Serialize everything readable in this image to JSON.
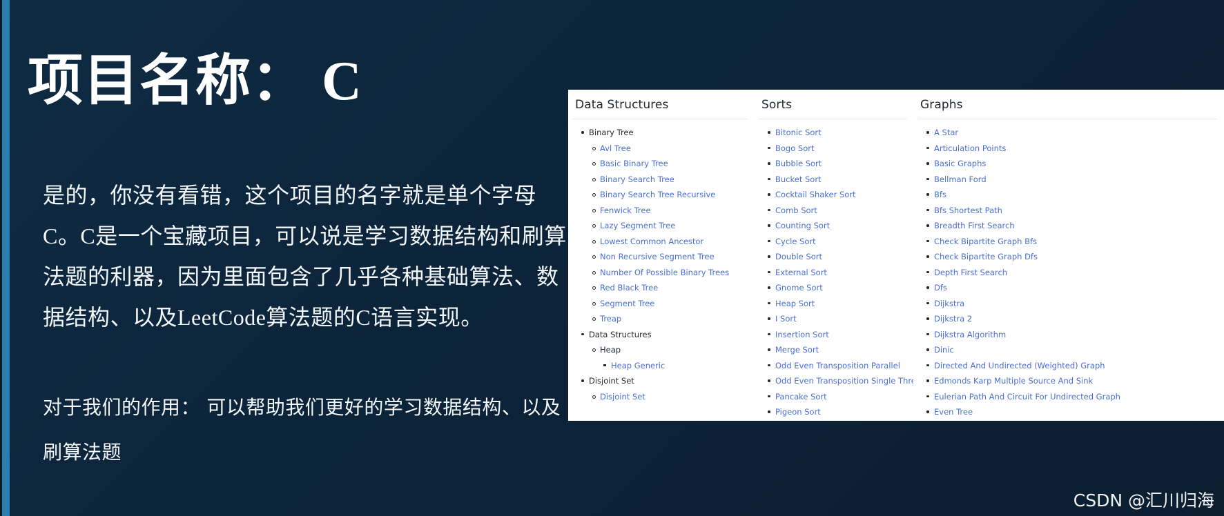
{
  "slide": {
    "title": "项目名称： C",
    "body_paragraph": "是的，你没有看错，这个项目的名字就是单个字母C。C是一个宝藏项目，可以说是学习数据结构和刷算法题的利器，因为里面包含了几乎各种基础算法、数据结构、以及LeetCode算法题的C语言实现。",
    "usage_note": "对于我们的作用： 可以帮助我们更好的学习数据结构、以及刷算法题",
    "watermark": "CSDN @汇川归海",
    "accent_color": "#2a7fb0",
    "background_color": "#0d2940",
    "link_color": "#4a6fd4"
  },
  "screenshot": {
    "columns": [
      {
        "title": "Data Structures",
        "items": [
          {
            "label": "Binary Tree",
            "depth": 0,
            "link": false
          },
          {
            "label": "Avl Tree",
            "depth": 1,
            "link": true
          },
          {
            "label": "Basic Binary Tree",
            "depth": 1,
            "link": true
          },
          {
            "label": "Binary Search Tree",
            "depth": 1,
            "link": true
          },
          {
            "label": "Binary Search Tree Recursive",
            "depth": 1,
            "link": true
          },
          {
            "label": "Fenwick Tree",
            "depth": 1,
            "link": true
          },
          {
            "label": "Lazy Segment Tree",
            "depth": 1,
            "link": true
          },
          {
            "label": "Lowest Common Ancestor",
            "depth": 1,
            "link": true
          },
          {
            "label": "Non Recursive Segment Tree",
            "depth": 1,
            "link": true
          },
          {
            "label": "Number Of Possible Binary Trees",
            "depth": 1,
            "link": true
          },
          {
            "label": "Red Black Tree",
            "depth": 1,
            "link": true
          },
          {
            "label": "Segment Tree",
            "depth": 1,
            "link": true
          },
          {
            "label": "Treap",
            "depth": 1,
            "link": true
          },
          {
            "label": "Data Structures",
            "depth": 0,
            "link": false
          },
          {
            "label": "Heap",
            "depth": 1,
            "link": false
          },
          {
            "label": "Heap Generic",
            "depth": 2,
            "link": true
          },
          {
            "label": "Disjoint Set",
            "depth": 0,
            "link": false
          },
          {
            "label": "Disjoint Set",
            "depth": 1,
            "link": true
          }
        ]
      },
      {
        "title": "Sorts",
        "items": [
          {
            "label": "Bitonic Sort",
            "depth": 0,
            "link": true
          },
          {
            "label": "Bogo Sort",
            "depth": 0,
            "link": true
          },
          {
            "label": "Bubble Sort",
            "depth": 0,
            "link": true
          },
          {
            "label": "Bucket Sort",
            "depth": 0,
            "link": true
          },
          {
            "label": "Cocktail Shaker Sort",
            "depth": 0,
            "link": true
          },
          {
            "label": "Comb Sort",
            "depth": 0,
            "link": true
          },
          {
            "label": "Counting Sort",
            "depth": 0,
            "link": true
          },
          {
            "label": "Cycle Sort",
            "depth": 0,
            "link": true
          },
          {
            "label": "Double Sort",
            "depth": 0,
            "link": true
          },
          {
            "label": "External Sort",
            "depth": 0,
            "link": true
          },
          {
            "label": "Gnome Sort",
            "depth": 0,
            "link": true
          },
          {
            "label": "Heap Sort",
            "depth": 0,
            "link": true
          },
          {
            "label": "I Sort",
            "depth": 0,
            "link": true
          },
          {
            "label": "Insertion Sort",
            "depth": 0,
            "link": true
          },
          {
            "label": "Merge Sort",
            "depth": 0,
            "link": true
          },
          {
            "label": "Odd Even Transposition Parallel",
            "depth": 0,
            "link": true
          },
          {
            "label": "Odd Even Transposition Single Threaded",
            "depth": 0,
            "link": true
          },
          {
            "label": "Pancake Sort",
            "depth": 0,
            "link": true
          },
          {
            "label": "Pigeon Sort",
            "depth": 0,
            "link": true
          }
        ]
      },
      {
        "title": "Graphs",
        "items": [
          {
            "label": "A Star",
            "depth": 0,
            "link": true
          },
          {
            "label": "Articulation Points",
            "depth": 0,
            "link": true
          },
          {
            "label": "Basic Graphs",
            "depth": 0,
            "link": true
          },
          {
            "label": "Bellman Ford",
            "depth": 0,
            "link": true
          },
          {
            "label": "Bfs",
            "depth": 0,
            "link": true
          },
          {
            "label": "Bfs Shortest Path",
            "depth": 0,
            "link": true
          },
          {
            "label": "Breadth First Search",
            "depth": 0,
            "link": true
          },
          {
            "label": "Check Bipartite Graph Bfs",
            "depth": 0,
            "link": true
          },
          {
            "label": "Check Bipartite Graph Dfs",
            "depth": 0,
            "link": true
          },
          {
            "label": "Depth First Search",
            "depth": 0,
            "link": true
          },
          {
            "label": "Dfs",
            "depth": 0,
            "link": true
          },
          {
            "label": "Dijkstra",
            "depth": 0,
            "link": true
          },
          {
            "label": "Dijkstra 2",
            "depth": 0,
            "link": true
          },
          {
            "label": "Dijkstra Algorithm",
            "depth": 0,
            "link": true
          },
          {
            "label": "Dinic",
            "depth": 0,
            "link": true
          },
          {
            "label": "Directed And Undirected (Weighted) Graph",
            "depth": 0,
            "link": true
          },
          {
            "label": "Edmonds Karp Multiple Source And Sink",
            "depth": 0,
            "link": true
          },
          {
            "label": "Eulerian Path And Circuit For Undirected Graph",
            "depth": 0,
            "link": true
          },
          {
            "label": "Even Tree",
            "depth": 0,
            "link": true
          }
        ]
      }
    ]
  }
}
